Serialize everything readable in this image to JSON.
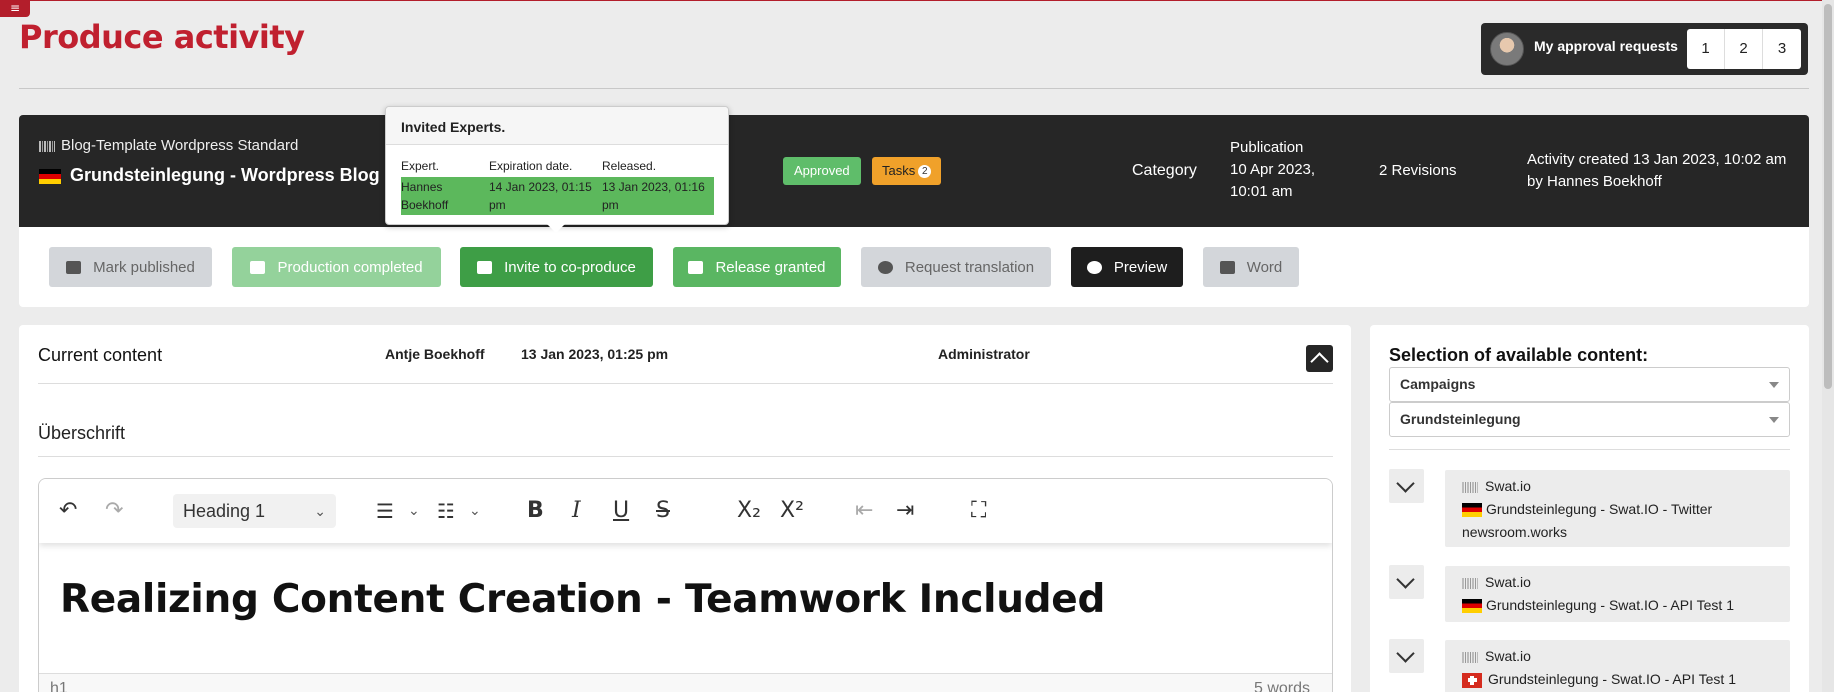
{
  "app": {
    "menu_icon": "hamburger-icon",
    "page_title": "Produce activity"
  },
  "approval": {
    "label": "My approval requests",
    "pages": [
      "1",
      "2",
      "3"
    ]
  },
  "activity": {
    "template": "Blog-Template Wordpress Standard",
    "title": "Grundsteinlegung - Wordpress Blog P",
    "status_approved": "Approved",
    "tasks_label": "Tasks",
    "tasks_count": "2",
    "category_label": "Category",
    "publication_label": "Publication",
    "publication_date": "10 Apr 2023,",
    "publication_time": "10:01 am",
    "revisions": "2 Revisions",
    "created_line1": "Activity created 13 Jan 2023, 10:02 am",
    "created_line2": "by Hannes Boekhoff"
  },
  "toolbar": {
    "mark_published": "Mark published",
    "production_completed": "Production completed",
    "invite": "Invite to co-produce",
    "release": "Release granted",
    "translation": "Request translation",
    "preview": "Preview",
    "word": "Word"
  },
  "invited": {
    "title": "Invited Experts.",
    "col_expert": "Expert.",
    "col_expiration": "Expiration date.",
    "col_released": "Released.",
    "row": {
      "expert": "Hannes Boekhoff",
      "expiration": "14 Jan 2023, 01:15 pm",
      "released": "13 Jan 2023, 01:16 pm"
    }
  },
  "content": {
    "title": "Current content",
    "user": "Antje Boekhoff",
    "date": "13 Jan 2023, 01:25 pm",
    "role": "Administrator",
    "section": "Überschrift",
    "editor": {
      "block_format": "Heading 1",
      "heading_text": "Realizing Content Creation - Teamwork Included",
      "status_left": "h1",
      "status_right": "5 words"
    }
  },
  "available": {
    "title": "Selection of available content:",
    "filter1": "Campaigns",
    "filter2": "Grundsteinlegung",
    "items": [
      {
        "source": "Swat.io",
        "text": "Grundsteinlegung - Swat.IO - Twitter newsroom.works",
        "flag": "de"
      },
      {
        "source": "Swat.io",
        "text": "Grundsteinlegung - Swat.IO - API Test 1",
        "flag": "de"
      },
      {
        "source": "Swat.io",
        "text": "Grundsteinlegung - Swat.IO - API Test 1",
        "flag": "ch"
      }
    ]
  },
  "colors": {
    "brand": "#c0202f",
    "dark_header": "#262626",
    "green": "#3e9e46",
    "tasks": "#f0a12a"
  }
}
